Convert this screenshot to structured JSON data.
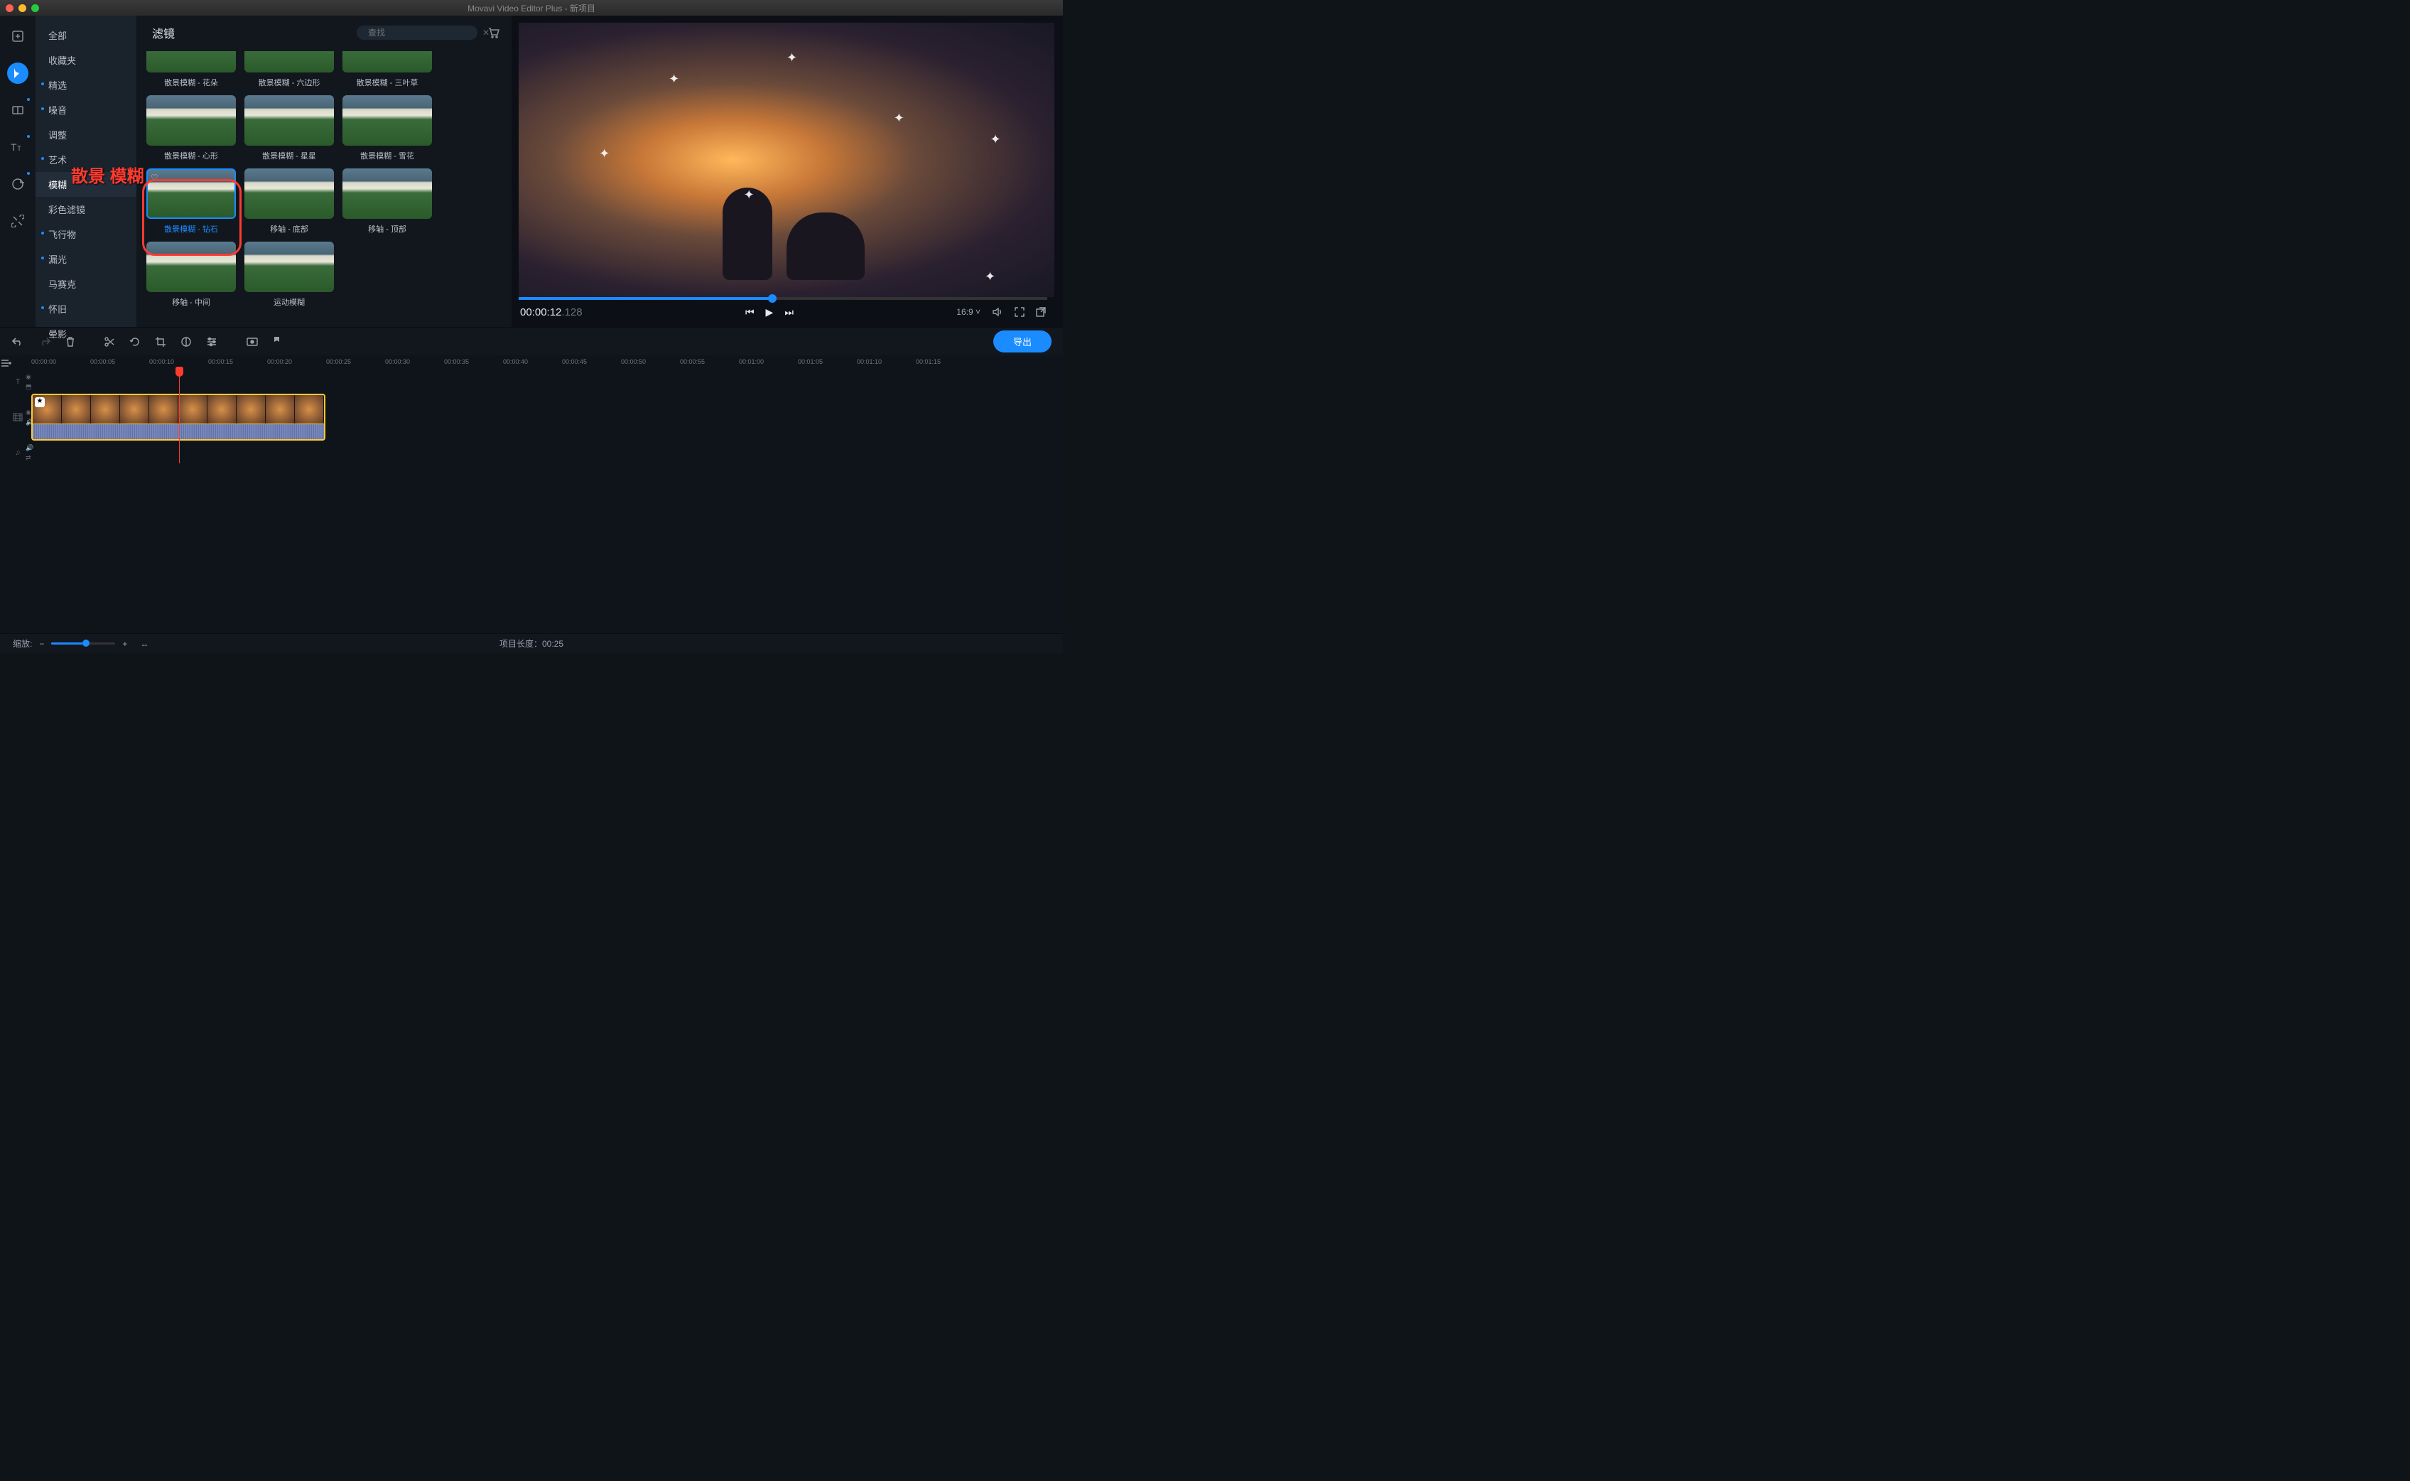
{
  "titlebar": {
    "title": "Movavi Video Editor Plus - 新项目"
  },
  "categories": [
    {
      "label": "全部",
      "active": false,
      "dot": false
    },
    {
      "label": "收藏夹",
      "active": false,
      "dot": false
    },
    {
      "label": "精选",
      "active": false,
      "dot": true
    },
    {
      "label": "噪音",
      "active": false,
      "dot": true
    },
    {
      "label": "调整",
      "active": false,
      "dot": false
    },
    {
      "label": "艺术",
      "active": false,
      "dot": true
    },
    {
      "label": "模糊",
      "active": true,
      "dot": false
    },
    {
      "label": "彩色滤镜",
      "active": false,
      "dot": false
    },
    {
      "label": "飞行物",
      "active": false,
      "dot": true
    },
    {
      "label": "漏光",
      "active": false,
      "dot": true
    },
    {
      "label": "马赛克",
      "active": false,
      "dot": false
    },
    {
      "label": "怀旧",
      "active": false,
      "dot": true
    },
    {
      "label": "晕影",
      "active": false,
      "dot": false
    }
  ],
  "filters_panel": {
    "title": "滤镜",
    "search_placeholder": "查找"
  },
  "filters": [
    {
      "label": "散景模糊 - 花朵",
      "short": true
    },
    {
      "label": "散景模糊 - 六边形",
      "short": true
    },
    {
      "label": "散景模糊 - 三叶草",
      "short": true
    },
    {
      "label": "散景模糊 - 心形"
    },
    {
      "label": "散景模糊 - 星星"
    },
    {
      "label": "散景模糊 - 雪花"
    },
    {
      "label": "散景模糊 - 钻石",
      "selected": true
    },
    {
      "label": "移轴 - 底部"
    },
    {
      "label": "移轴 - 顶部"
    },
    {
      "label": "移轴 - 中间"
    },
    {
      "label": "运动模糊"
    }
  ],
  "annotation": {
    "text": "散景 模糊"
  },
  "preview": {
    "timecode": "00:00:12",
    "timecode_frac": ".128",
    "aspect": "16:9",
    "aspect_arrow": "˅"
  },
  "export": {
    "label": "导出"
  },
  "ruler": [
    "00:00:00",
    "00:00:05",
    "00:00:10",
    "00:00:15",
    "00:00:20",
    "00:00:25",
    "00:00:30",
    "00:00:35",
    "00:00:40",
    "00:00:45",
    "00:00:50",
    "00:00:55",
    "00:01:00",
    "00:01:05",
    "00:01:10",
    "00:01:15"
  ],
  "bottom": {
    "zoom_label": "缩放:",
    "zoom_minus": "−",
    "zoom_plus": "+",
    "fit_icon": "↔",
    "project_len_label": "项目长度：",
    "project_len": "00:25"
  }
}
